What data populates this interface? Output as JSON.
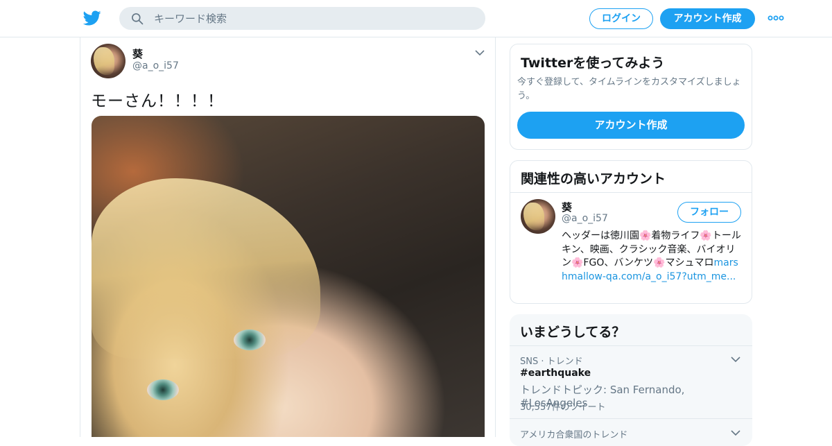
{
  "header": {
    "search_placeholder": "キーワード検索",
    "login_label": "ログイン",
    "signup_label": "アカウント作成",
    "brand_color": "#1da1f2"
  },
  "tweet": {
    "author_name": "葵",
    "author_handle": "@a_o_i57",
    "text": "モーさん！！！！"
  },
  "signup_panel": {
    "title": "Twitterを使ってみよう",
    "subtitle": "今すぐ登録して、タイムラインをカスタマイズしましょう。",
    "button_label": "アカウント作成"
  },
  "related_panel": {
    "title": "関連性の高いアカウント",
    "account": {
      "name": "葵",
      "handle": "@a_o_i57",
      "follow_label": "フォロー",
      "bio_text": "ヘッダーは徳川園🌸着物ライフ🌸トールキン、映画、クラシック音楽、バイオリン🌸FGO、バンケツ🌸マシュマロ",
      "bio_link": "marshmallow-qa.com/a_o_i57?utm_me..."
    }
  },
  "trends_panel": {
    "title": "いまどうしてる？",
    "items": [
      {
        "context": "SNS · トレンド",
        "name": "#earthquake",
        "description": "トレンドトピック: San Fernando, #LosAngeles",
        "count": "30,557件のツイート"
      },
      {
        "context": "アメリカ合衆国のトレンド"
      }
    ]
  }
}
